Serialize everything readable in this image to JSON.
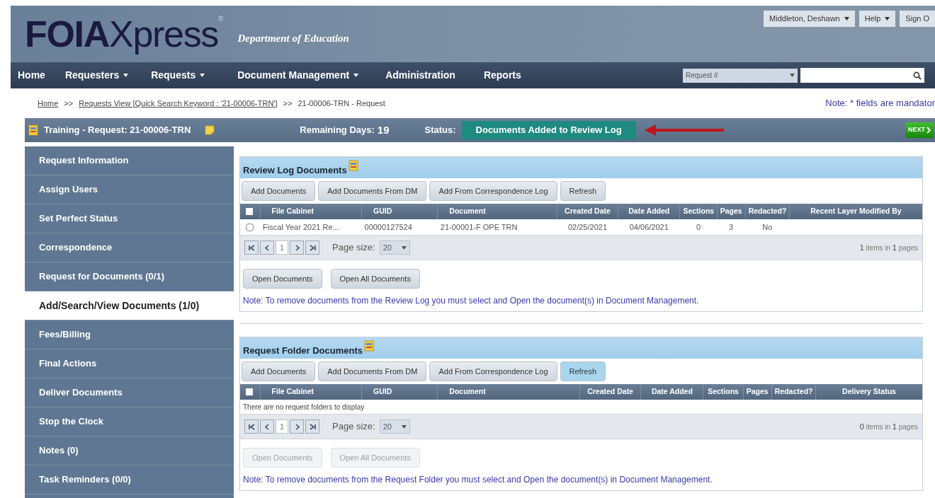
{
  "header": {
    "logo_bold": "FOIA",
    "logo_light": "Xpress",
    "logo_mark": "®",
    "department": "Department of Education",
    "user_buttons": [
      {
        "label": "Middleton, Deshawn",
        "dropdown": true
      },
      {
        "label": "Help",
        "dropdown": true
      },
      {
        "label": "Sign O",
        "dropdown": false
      }
    ]
  },
  "nav": {
    "items": [
      {
        "label": "Home",
        "dropdown": false
      },
      {
        "label": "Requesters",
        "dropdown": true
      },
      {
        "label": "Requests",
        "dropdown": true
      },
      {
        "label": "Document Management",
        "dropdown": true
      },
      {
        "label": "Administration",
        "dropdown": false
      },
      {
        "label": "Reports",
        "dropdown": false
      }
    ],
    "search_type": "Request #"
  },
  "breadcrumb": {
    "items": [
      {
        "label": "Home",
        "link": true
      },
      {
        "label": ">>",
        "link": false
      },
      {
        "label": "Requests View [Quick Search Keyword : '21-00006-TRN']",
        "link": true
      },
      {
        "label": ">>",
        "link": false
      },
      {
        "label": "21-00006-TRN - Request",
        "link": false
      }
    ],
    "note": "Note: * fields are mandator"
  },
  "request_bar": {
    "title": "Training - Request: 21-00006-TRN",
    "remaining_label": "Remaining Days:",
    "remaining_value": "19",
    "status_label": "Status:",
    "status": "Documents Added to Review Log",
    "next": "NEXT"
  },
  "sidebar": {
    "items": [
      {
        "label": "Request Information",
        "selected": false
      },
      {
        "label": "Assign Users",
        "selected": false
      },
      {
        "label": "Set Perfect Status",
        "selected": false
      },
      {
        "label": "Correspondence",
        "selected": false
      },
      {
        "label": "Request for Documents (0/1)",
        "selected": false
      },
      {
        "label": "Add/Search/View Documents (1/0)",
        "selected": true
      },
      {
        "label": "Fees/Billing",
        "selected": false
      },
      {
        "label": "Final Actions",
        "selected": false
      },
      {
        "label": "Deliver Documents",
        "selected": false
      },
      {
        "label": "Stop the Clock",
        "selected": false
      },
      {
        "label": "Notes (0)",
        "selected": false
      },
      {
        "label": "Task Reminders (0/0)",
        "selected": false
      }
    ]
  },
  "panels": [
    {
      "title": "Review Log Documents",
      "toolbar": [
        {
          "label": "Add Documents",
          "highlighted": false
        },
        {
          "label": "Add Documents From DM",
          "highlighted": false
        },
        {
          "label": "Add From Correspondence Log",
          "highlighted": false
        },
        {
          "label": "Refresh",
          "highlighted": false
        }
      ],
      "columns": [
        "File Cabinet",
        "GUID",
        "Document",
        "Created Date",
        "Date Added",
        "Sections",
        "Pages",
        "Redacted?",
        "Recent Layer Modified By"
      ],
      "select_all_checked": false,
      "rows": [
        {
          "checked": false,
          "cells": [
            "Fiscal Year 2021 Re...",
            "00000127524",
            "21-00001-F OPE TRN",
            "02/25/2021",
            "04/06/2021",
            "0",
            "3",
            "No",
            ""
          ]
        }
      ],
      "page": "1",
      "page_size_label": "Page size:",
      "page_size": "20",
      "pager_count": "1",
      "pager_middle": "items in",
      "pager_pages": "1",
      "pager_end": "pages",
      "actions": [
        {
          "label": "Open Documents",
          "disabled": false
        },
        {
          "label": "Open All Documents",
          "disabled": false
        }
      ],
      "note": "Note: To remove documents from the Review Log you must select and Open the document(s) in Document Management."
    },
    {
      "title": "Request Folder Documents",
      "toolbar": [
        {
          "label": "Add Documents",
          "highlighted": false
        },
        {
          "label": "Add Documents From DM",
          "highlighted": false
        },
        {
          "label": "Add From Correspondence Log",
          "highlighted": false
        },
        {
          "label": "Refresh",
          "highlighted": true
        }
      ],
      "columns": [
        "File Cabinet",
        "GUID",
        "Document",
        "Created Date",
        "Date Added",
        "Sections",
        "Pages",
        "Redacted?",
        "Delivery Status"
      ],
      "select_all_checked": false,
      "empty": "There are no request folders to display",
      "page": "1",
      "page_size_label": "Page size:",
      "page_size": "20",
      "pager_count": "0",
      "pager_middle": "items in",
      "pager_pages": "1",
      "pager_end": "pages",
      "actions": [
        {
          "label": "Open Documents",
          "disabled": true
        },
        {
          "label": "Open All Documents",
          "disabled": true
        }
      ],
      "note": "Note: To remove documents from the Request Folder you must select and Open the document(s) in Document Management."
    }
  ]
}
